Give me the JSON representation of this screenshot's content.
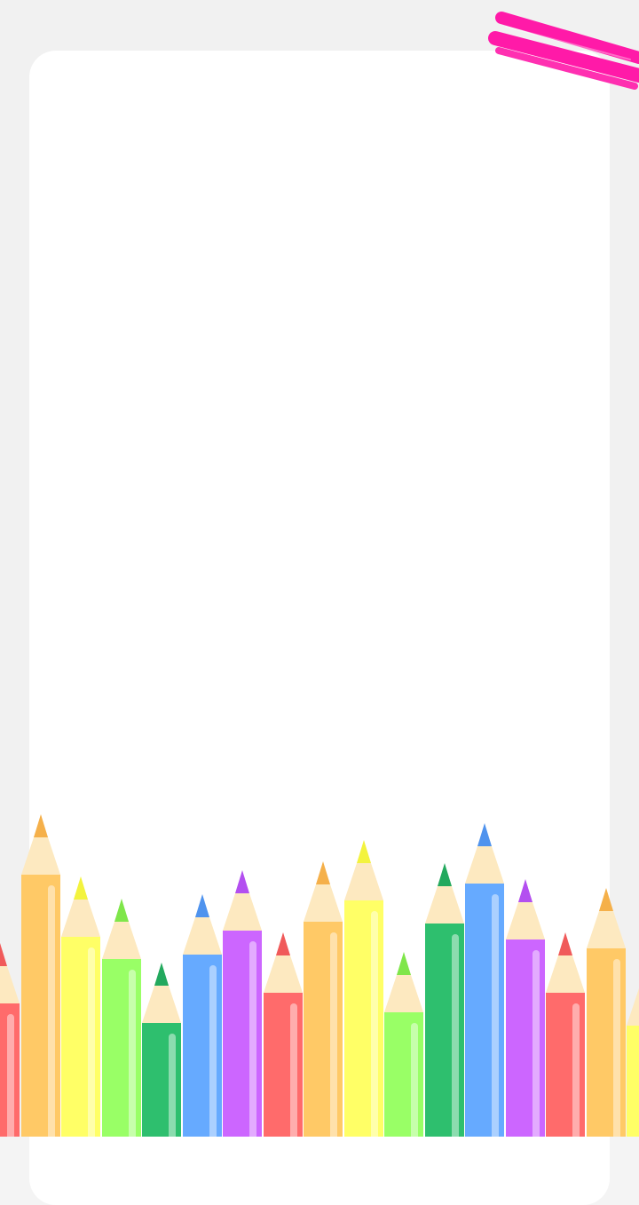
{
  "theme": {
    "background": "#f4f4f4",
    "card": "#ffffff",
    "scribble": "#ff1aa8",
    "wood": "#fde9c0"
  },
  "decor": {
    "scribble_icon": "pink-marker-scribble",
    "pencil_icon": "colored-pencil"
  },
  "pencils": [
    {
      "color": "#ff6b6b",
      "tip": "#f05a5a"
    },
    {
      "color": "#ffc966",
      "tip": "#f5b04a"
    },
    {
      "color": "#ffff66",
      "tip": "#f3f33e"
    },
    {
      "color": "#99ff66",
      "tip": "#7fe64a"
    },
    {
      "color": "#2ebf6e",
      "tip": "#23a95e"
    },
    {
      "color": "#66aaff",
      "tip": "#4f93ee"
    },
    {
      "color": "#cc66ff",
      "tip": "#b34ff0"
    },
    {
      "color": "#ff6b6b",
      "tip": "#f05a5a"
    },
    {
      "color": "#ffc966",
      "tip": "#f5b04a"
    },
    {
      "color": "#ffff66",
      "tip": "#f3f33e"
    },
    {
      "color": "#99ff66",
      "tip": "#7fe64a"
    },
    {
      "color": "#2ebf6e",
      "tip": "#23a95e"
    },
    {
      "color": "#66aaff",
      "tip": "#4f93ee"
    },
    {
      "color": "#cc66ff",
      "tip": "#b34ff0"
    },
    {
      "color": "#ff6b6b",
      "tip": "#f05a5a"
    },
    {
      "color": "#ffc966",
      "tip": "#f5b04a"
    },
    {
      "color": "#ffff66",
      "tip": "#f3f33e"
    }
  ]
}
